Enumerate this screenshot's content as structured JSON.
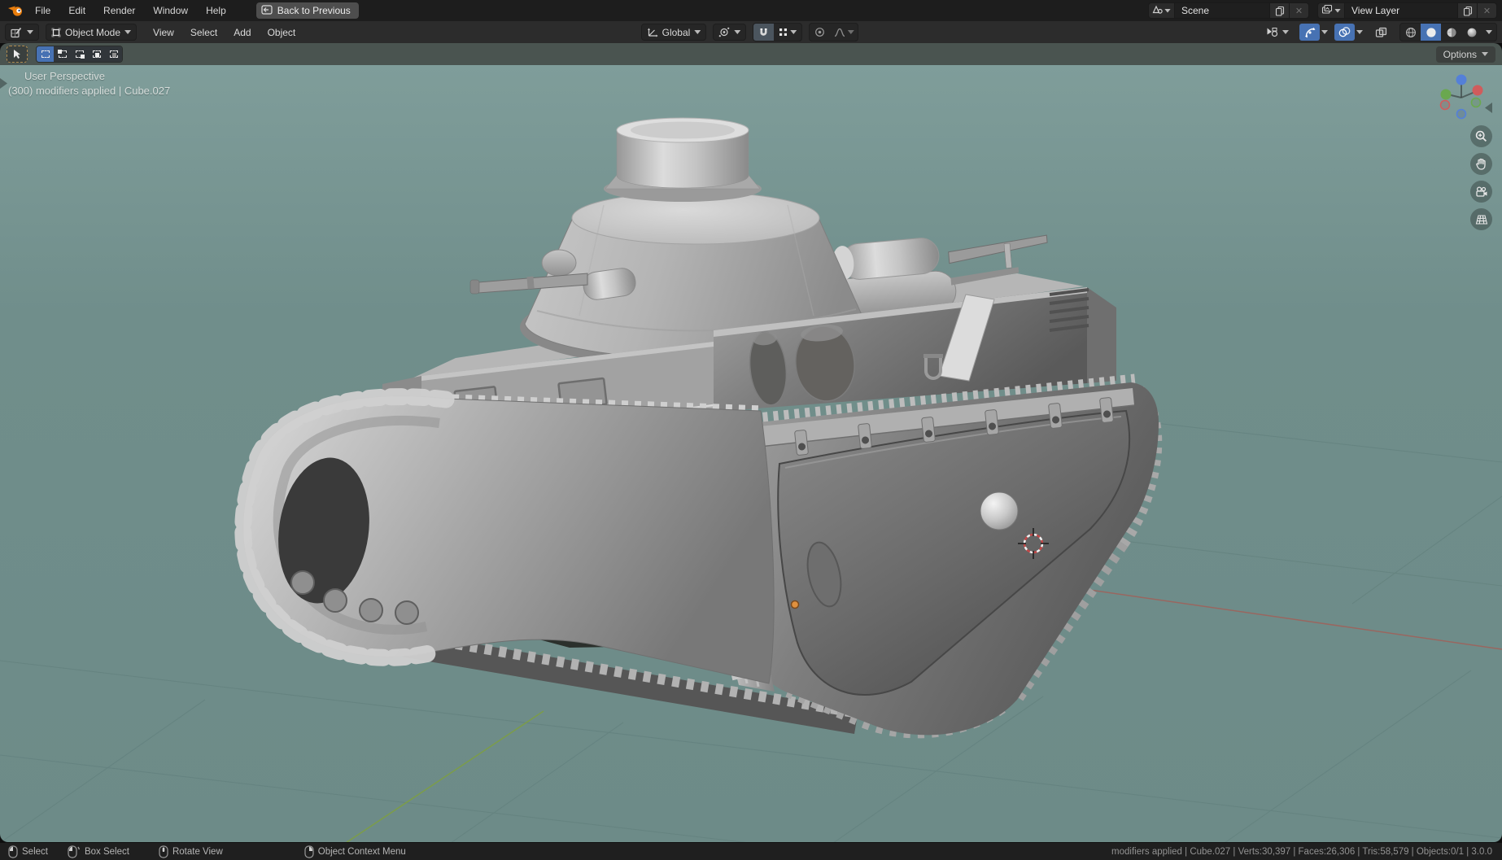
{
  "topbar": {
    "menus": [
      "File",
      "Edit",
      "Render",
      "Window",
      "Help"
    ],
    "back_button_label": "Back to Previous",
    "scene_selector": {
      "label": "Scene"
    },
    "view_layer_selector": {
      "label": "View Layer"
    }
  },
  "toolbar": {
    "mode_label": "Object Mode",
    "menus": [
      "View",
      "Select",
      "Add",
      "Object"
    ],
    "orientation_label": "Global",
    "options_label": "Options"
  },
  "viewport": {
    "perspective_label": "User Perspective",
    "info_label": "(300) modifiers applied | Cube.027"
  },
  "statusbar": {
    "hints": [
      {
        "icon": "mouse-left-icon",
        "label": "Select"
      },
      {
        "icon": "mouse-left-drag-icon",
        "label": "Box Select"
      },
      {
        "icon": "mouse-middle-icon",
        "label": "Rotate View"
      },
      {
        "icon": "mouse-right-icon",
        "label": "Object Context Menu"
      }
    ],
    "stats": "modifiers applied | Cube.027 | Verts:30,397 | Faces:26,306 | Tris:58,579 | Objects:0/1 | 3.0.0"
  },
  "icons": {
    "blender-logo-icon": "orange blender swirl",
    "editor-type-icon": "3d viewport editor selector",
    "object-mode-icon": "white square outline",
    "transform-orientation-icon": "axis arrows",
    "pivot-point-icon": "circle with dot",
    "snap-magnet-icon": "magnet (enabled)",
    "snap-target-icon": "four dots",
    "proportional-edit-icon": "circle with center dot",
    "falloff-curve-icon": "bell curve",
    "object-visibility-icon": "cursor over shapes",
    "gizmo-toggle-icon": "rotation arc (enabled)",
    "overlays-toggle-icon": "two circles (enabled)",
    "xray-toggle-icon": "overlapping squares",
    "shading-wireframe-icon": "wire globe",
    "shading-solid-icon": "white sphere (active)",
    "shading-material-icon": "checker sphere",
    "shading-rendered-icon": "shaded sphere",
    "navigation-axis-gizmo": "xyz orbit balls",
    "zoom-icon": "magnifier",
    "pan-hand-icon": "hand",
    "camera-view-icon": "camera",
    "ortho-grid-icon": "perspective grid"
  },
  "colors": {
    "accent_blue": "#4772b3",
    "viewport_top": "#7f9d9a",
    "viewport_bottom": "#6d8b88",
    "axis_green": "#7d9e45",
    "axis_red": "#a85a52",
    "header_bg": "#2c2c2c",
    "topbar_bg": "#1d1d1d"
  }
}
